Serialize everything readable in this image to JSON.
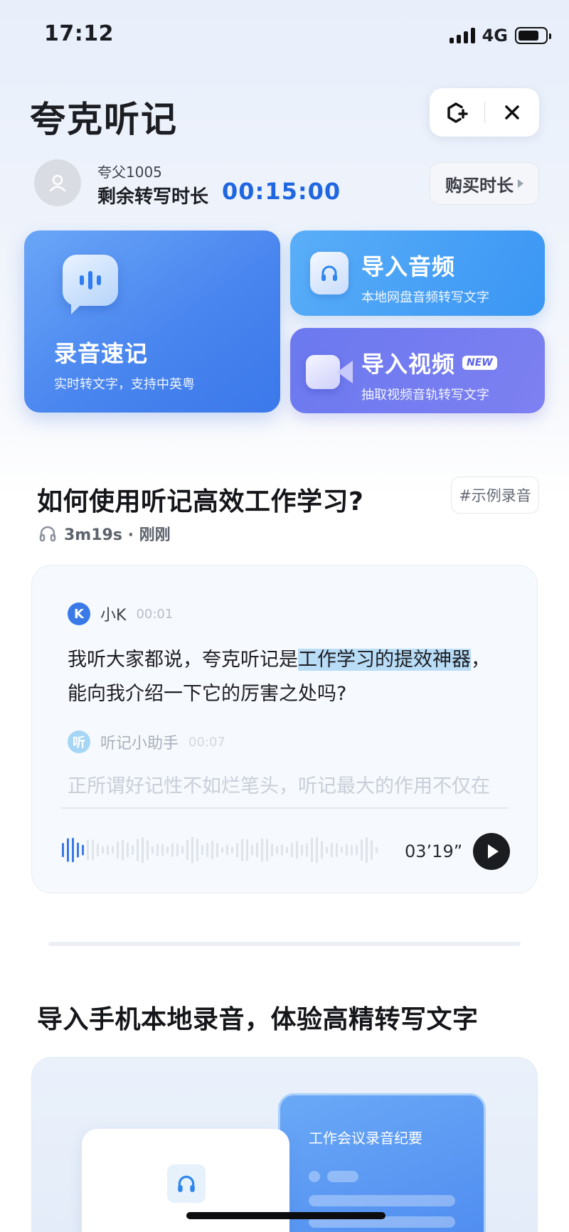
{
  "status_bar": {
    "time": "17:12",
    "network": "4G"
  },
  "header": {
    "title": "夸克听记"
  },
  "account": {
    "username": "夸父1005",
    "quota_label": "剩余转写时长",
    "quota_value": "00:15:00",
    "buy_label": "购买时长"
  },
  "cards": {
    "record": {
      "title": "录音速记",
      "subtitle": "实时转文字，支持中英粤"
    },
    "audio": {
      "title": "导入音频",
      "subtitle": "本地网盘音频转写文字"
    },
    "video": {
      "title": "导入视频",
      "badge": "NEW",
      "subtitle": "抽取视频音轨转写文字"
    }
  },
  "example": {
    "title": "如何使用听记高效工作学习?",
    "tag": "#示例录音",
    "meta": "3m19s · 刚刚",
    "speaker1": {
      "avatar": "K",
      "name": "小K",
      "time": "00:01"
    },
    "line1_pre": "我听大家都说，夸克听记是",
    "line1_highlight": "工作学习的提效神器",
    "line1_post": "，",
    "line2": "能向我介绍一下它的厉害之处吗?",
    "speaker2": {
      "avatar": "听",
      "name": "听记小助手",
      "time": "00:07"
    },
    "line3": "正所谓好记性不如烂笔头，听记最大的作用不仅在",
    "duration": "03’19”",
    "colors": {
      "accent": "#1f66e0",
      "highlight": "#b9ddf7",
      "speaker1": "#3a7ae8",
      "speaker2": "#a6d6f5"
    }
  },
  "import_section": {
    "title": "导入手机本地录音，体验高精转写文字",
    "doc_title": "工作会议录音纪要"
  },
  "icons": {
    "add_widget": "add-widget-icon",
    "close": "close-icon",
    "avatar": "user-icon",
    "headphones": "headphones-icon",
    "play": "play-icon"
  }
}
